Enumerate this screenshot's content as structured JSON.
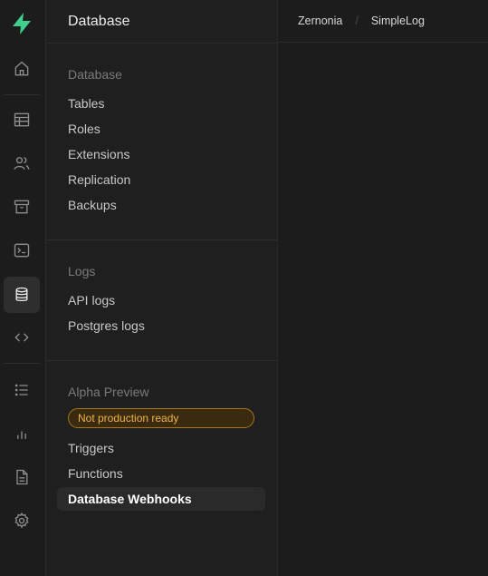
{
  "rail": {
    "icons": [
      "logo-icon",
      "home-icon",
      "table-icon",
      "users-icon",
      "archive-icon",
      "terminal-icon",
      "database-icon",
      "code-icon",
      "list-icon",
      "bar-chart-icon",
      "document-icon",
      "gear-icon"
    ]
  },
  "menu": {
    "title": "Database",
    "sections": [
      {
        "title": "Database",
        "items": [
          "Tables",
          "Roles",
          "Extensions",
          "Replication",
          "Backups"
        ]
      },
      {
        "title": "Logs",
        "items": [
          "API logs",
          "Postgres logs"
        ]
      },
      {
        "title": "Alpha Preview",
        "badge": "Not production ready",
        "items": [
          "Triggers",
          "Functions",
          "Database Webhooks"
        ]
      }
    ]
  },
  "breadcrumb": {
    "org": "Zernonia",
    "project": "SimpleLog"
  },
  "colors": {
    "accent": "#3ecf8e",
    "badge_border": "#a8761b",
    "badge_text": "#f0b44a"
  }
}
